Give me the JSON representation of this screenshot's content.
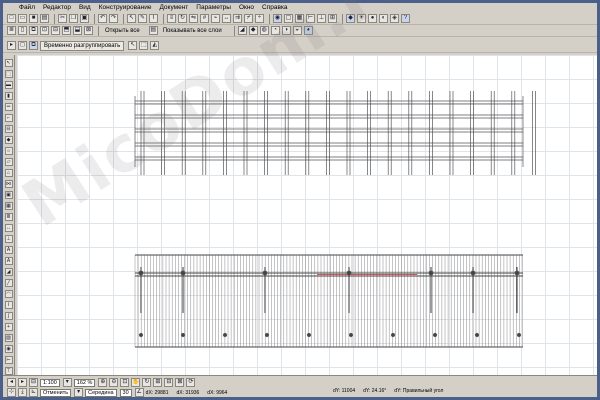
{
  "menu": [
    "Файл",
    "Редактор",
    "Вид",
    "Конструирование",
    "Документ",
    "Параметры",
    "Окно",
    "Справка"
  ],
  "toolbar2": {
    "open_all_label": "Открыть все",
    "show_all_layers_label": "Показывать все слои"
  },
  "toolbar3": {
    "temporary_ungroup_label": "Временно разгруппировать"
  },
  "bottom": {
    "scale": "1:100",
    "zoom": "162 %",
    "layer": "Отменить",
    "combo": "Середина",
    "angle": "30",
    "cx1": "dX: 29881",
    "cy1": "dY: 11004",
    "cx2": "dX: 31936",
    "cy2": "dY: 24.16°",
    "cx3": "dX: 9964",
    "cy3": "dY: Правильный угол"
  },
  "watermark": "MicoDom.ru",
  "colors": {
    "frame": "#4a5f8a",
    "window": "#d4d0c8",
    "canvas": "#ffffff",
    "grid": "#dfe3ea",
    "drawing": "#555555",
    "red_accent": "#cc2222"
  }
}
